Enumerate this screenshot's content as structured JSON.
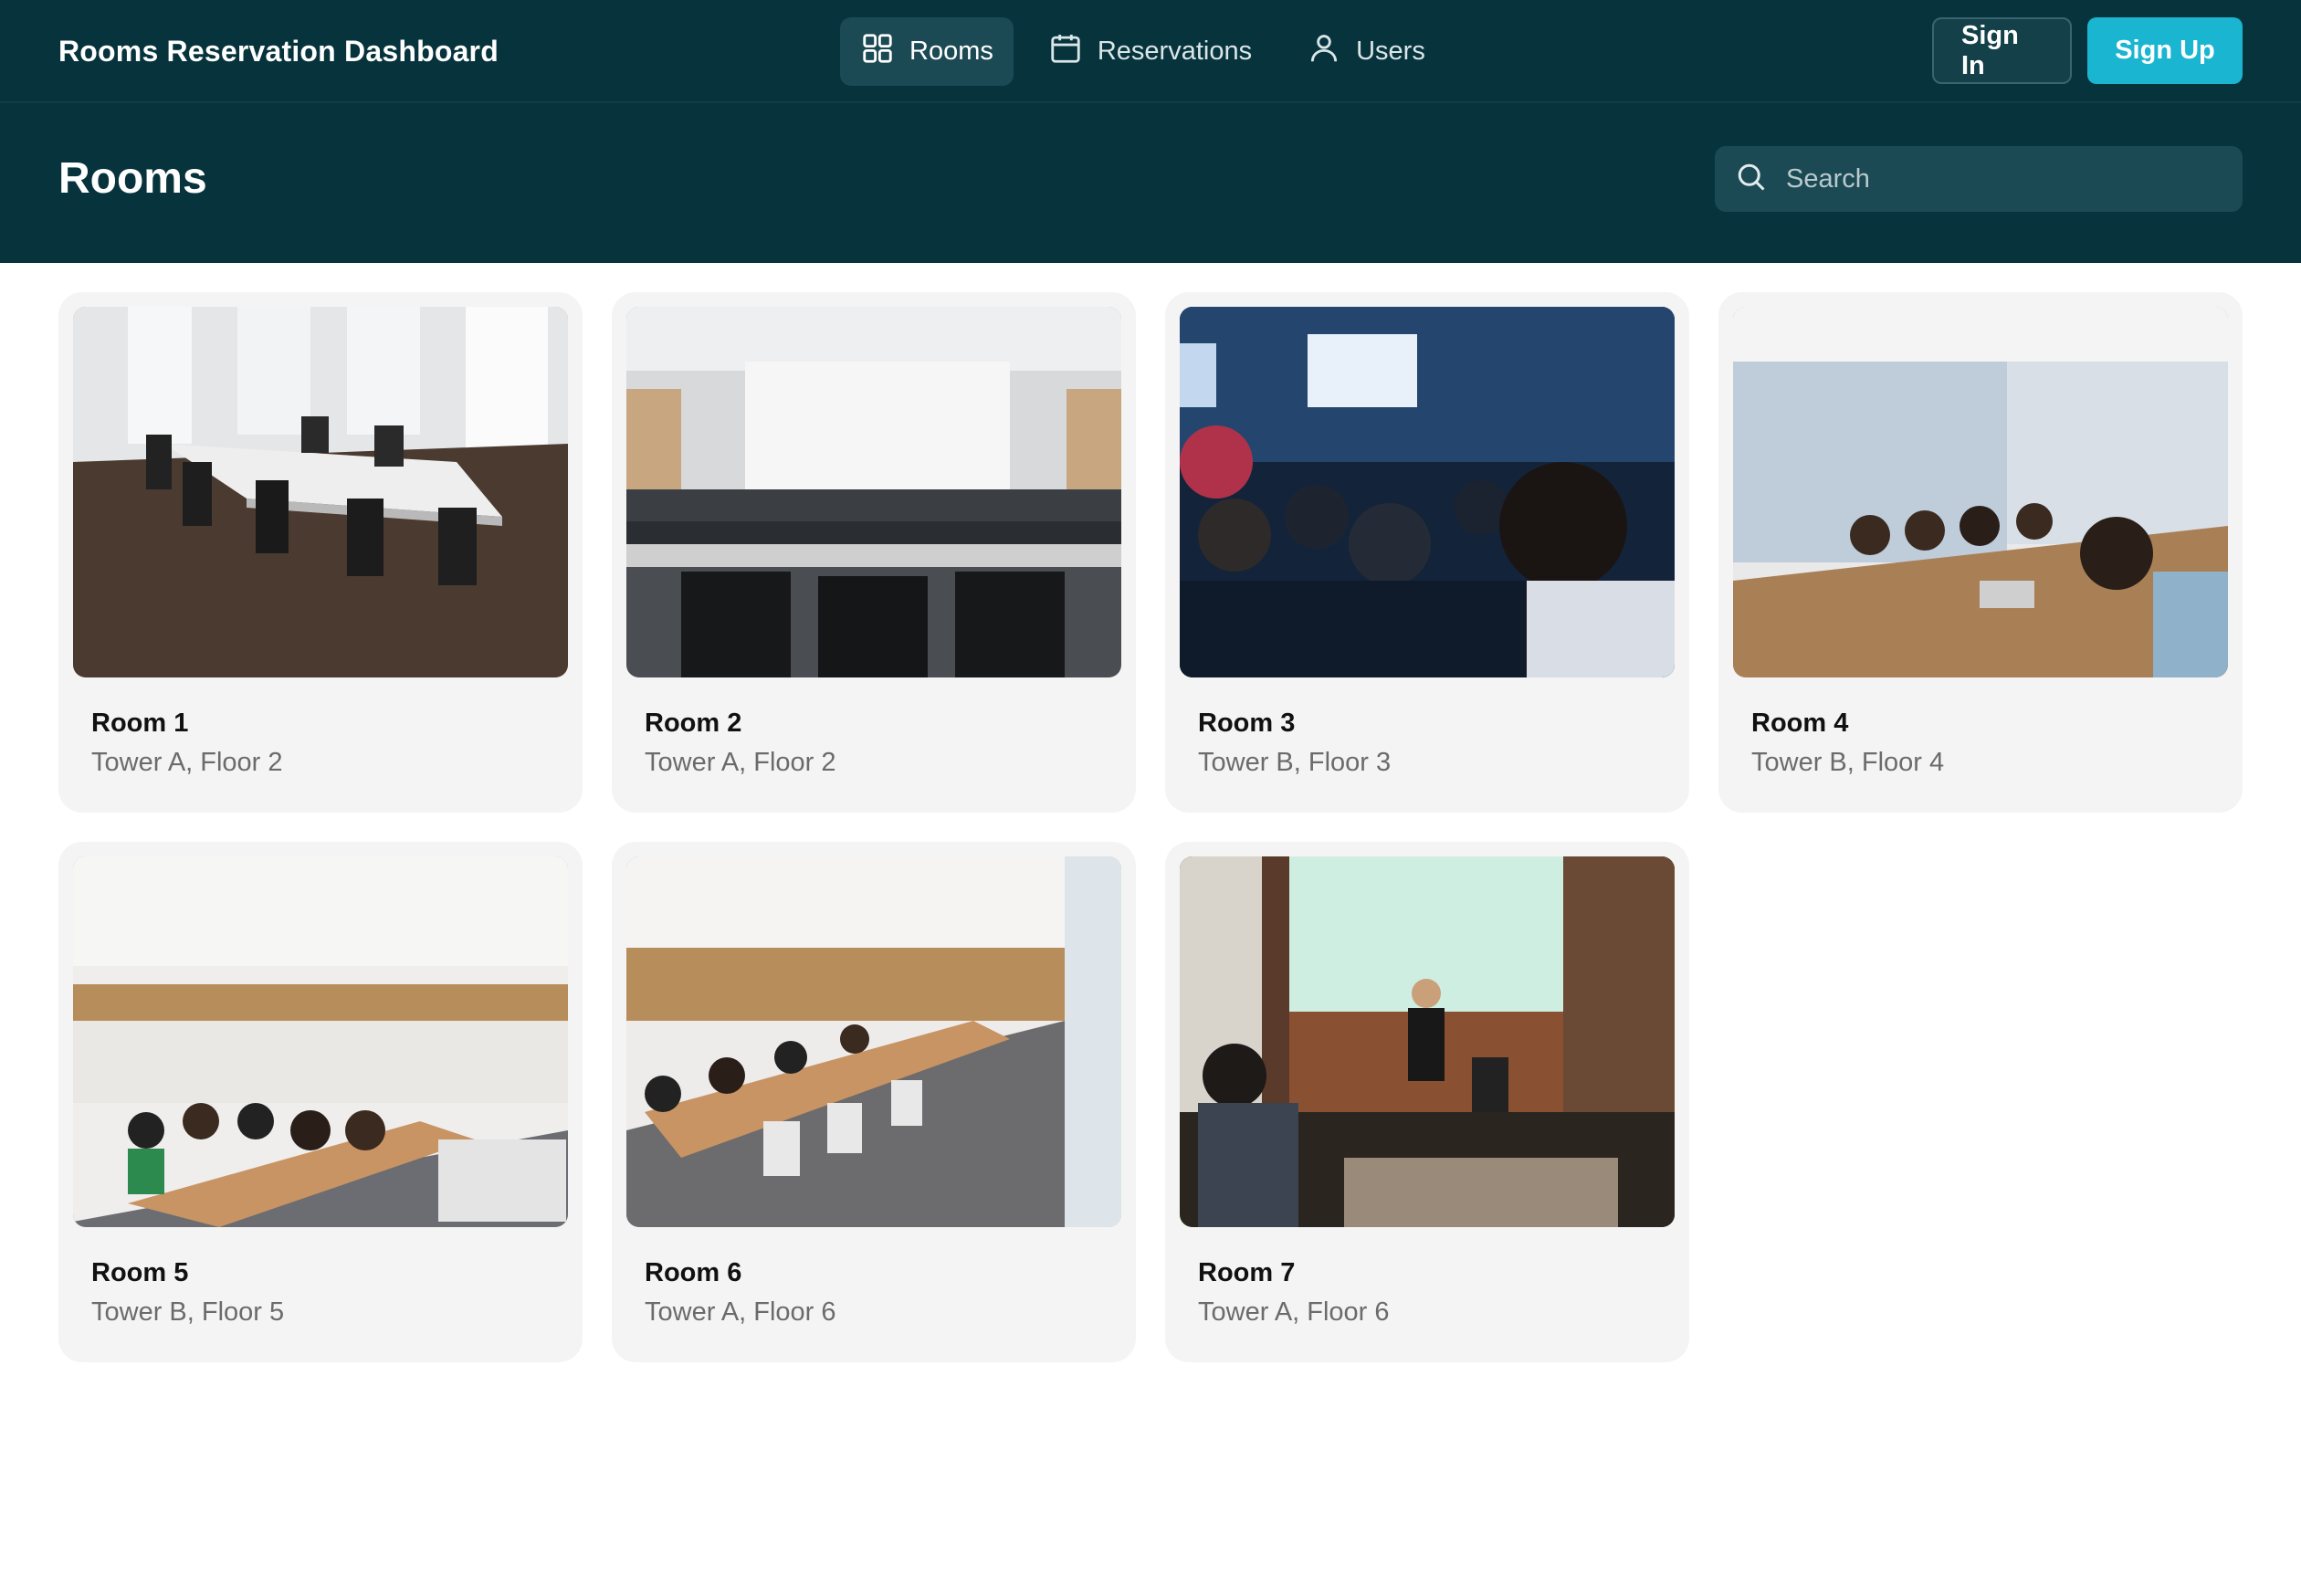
{
  "app": {
    "title": "Rooms Reservation Dashboard"
  },
  "nav": {
    "items": [
      {
        "label": "Rooms",
        "icon": "grid-icon",
        "active": true
      },
      {
        "label": "Reservations",
        "icon": "calendar-icon",
        "active": false
      },
      {
        "label": "Users",
        "icon": "user-icon",
        "active": false
      }
    ]
  },
  "auth": {
    "sign_in": "Sign In",
    "sign_up": "Sign Up"
  },
  "page": {
    "title": "Rooms"
  },
  "search": {
    "placeholder": "Search",
    "value": ""
  },
  "rooms": [
    {
      "name": "Room 1",
      "location": "Tower A, Floor 2",
      "photo": "empty boardroom with long white table"
    },
    {
      "name": "Room 2",
      "location": "Tower A, Floor 2",
      "photo": "lecture hall with projector screen"
    },
    {
      "name": "Room 3",
      "location": "Tower B, Floor 3",
      "photo": "audience at an event"
    },
    {
      "name": "Room 4",
      "location": "Tower B, Floor 4",
      "photo": "meeting around long table"
    },
    {
      "name": "Room 5",
      "location": "Tower B, Floor 5",
      "photo": "classroom with presenter"
    },
    {
      "name": "Room 6",
      "location": "Tower A, Floor 6",
      "photo": "long conference room with students"
    },
    {
      "name": "Room 7",
      "location": "Tower A, Floor 6",
      "photo": "speaker on stage with screen"
    }
  ],
  "colors": {
    "nav_bg": "#06333c",
    "accent": "#1ab5d0",
    "card_bg": "#f4f4f4"
  }
}
